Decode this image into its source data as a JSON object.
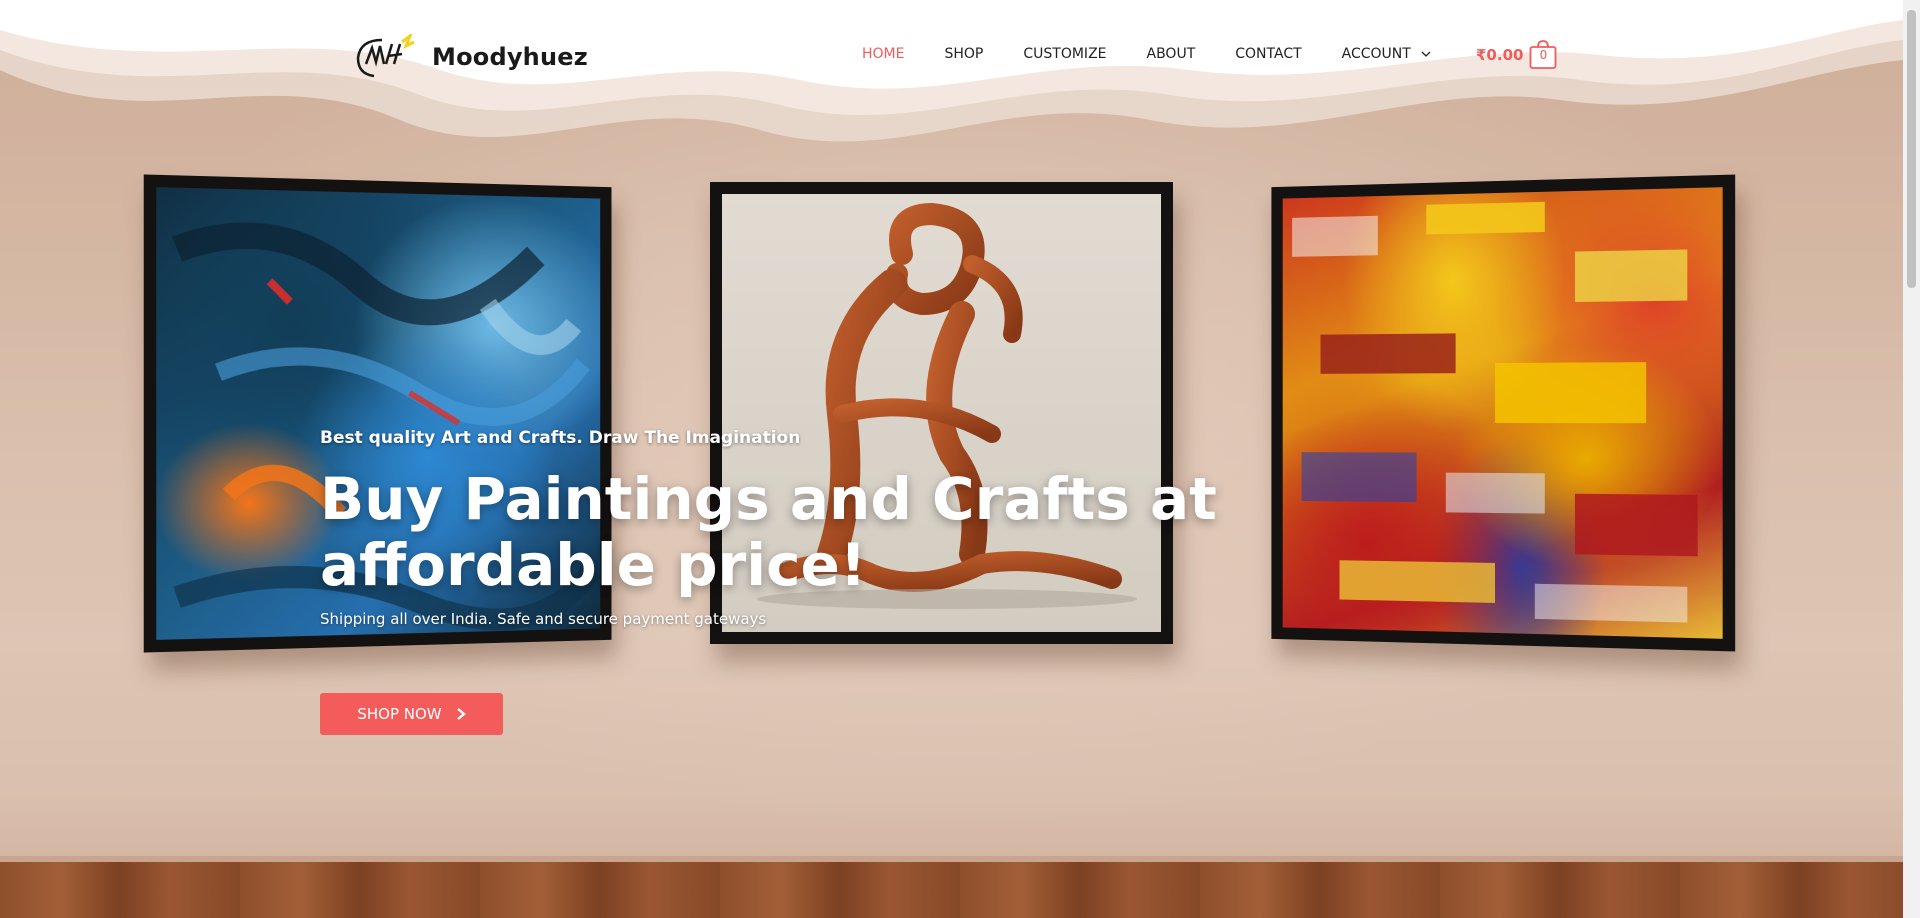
{
  "site": {
    "title": "Moodyhuez",
    "logo_icon": "signature-logo-icon"
  },
  "nav": {
    "items": [
      {
        "label": "HOME",
        "active": true
      },
      {
        "label": "SHOP",
        "active": false
      },
      {
        "label": "CUSTOMIZE",
        "active": false
      },
      {
        "label": "ABOUT",
        "active": false
      },
      {
        "label": "CONTACT",
        "active": false
      },
      {
        "label": "ACCOUNT",
        "active": false,
        "has_dropdown": true
      }
    ],
    "accent_color": "#f25b5b"
  },
  "cart": {
    "total": "₹0.00",
    "count": "0",
    "icon": "shopping-bag-icon"
  },
  "hero": {
    "tagline": "Best quality Art and Crafts. Draw The Imagination",
    "headline": "Buy Paintings and Crafts at affordable price!",
    "subline": "Shipping all over India. Safe and secure payment gateways",
    "cta_label": "SHOP NOW",
    "cta_color": "#f45b5b"
  }
}
